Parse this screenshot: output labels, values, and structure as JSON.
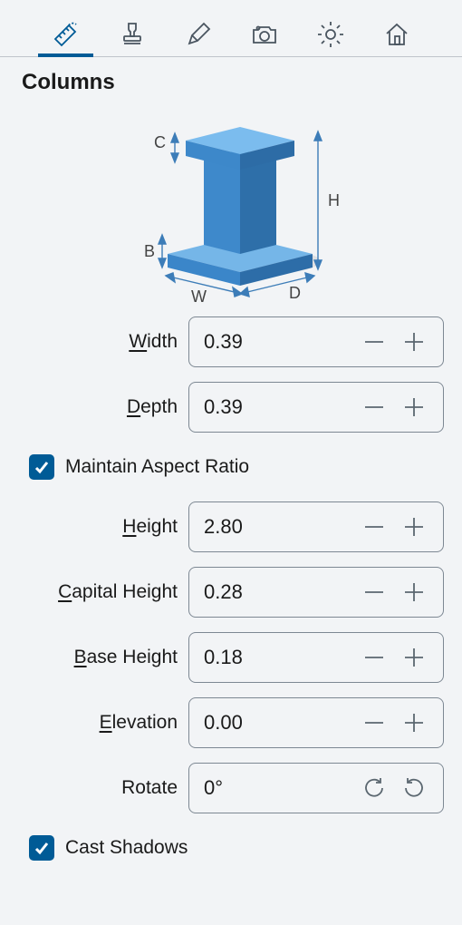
{
  "tabs": {
    "items": [
      "dimensions",
      "materials",
      "edit",
      "camera",
      "lighting",
      "scene"
    ]
  },
  "panel": {
    "title": "Columns"
  },
  "diagram": {
    "labels": {
      "c": "C",
      "h": "H",
      "b": "B",
      "w": "W",
      "d": "D"
    }
  },
  "fields": {
    "width": {
      "label_pre": "",
      "mn": "W",
      "label_post": "idth",
      "value": "0.39"
    },
    "depth": {
      "label_pre": "",
      "mn": "D",
      "label_post": "epth",
      "value": "0.39"
    },
    "height": {
      "label_pre": "",
      "mn": "H",
      "label_post": "eight",
      "value": "2.80"
    },
    "capital_height": {
      "label_pre": "",
      "mn": "C",
      "label_post": "apital Height",
      "value": "0.28"
    },
    "base_height": {
      "label_pre": "",
      "mn": "B",
      "label_post": "ase Height",
      "value": "0.18"
    },
    "elevation": {
      "label_pre": "",
      "mn": "E",
      "label_post": "levation",
      "value": "0.00"
    },
    "rotate": {
      "label": "Rotate",
      "value": "0°"
    }
  },
  "checks": {
    "aspect": {
      "label": "Maintain Aspect Ratio",
      "checked": true
    },
    "shadows": {
      "label": "Cast Shadows",
      "checked": true
    }
  }
}
